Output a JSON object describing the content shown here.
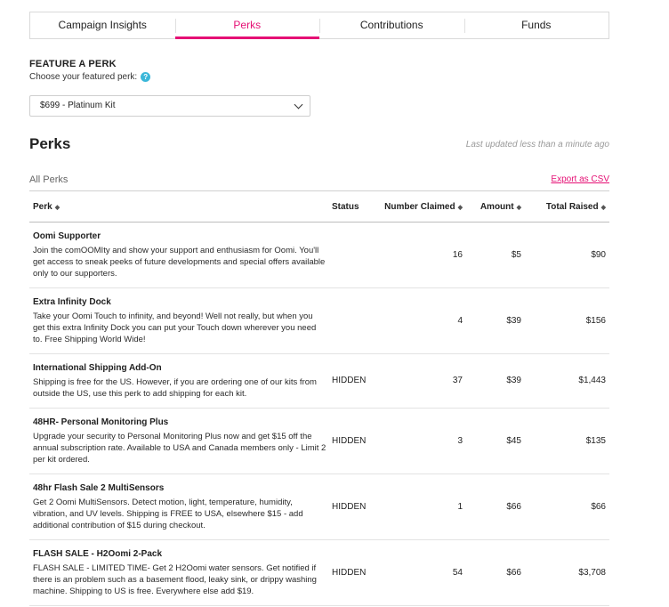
{
  "tabs": [
    {
      "label": "Campaign Insights",
      "active": false
    },
    {
      "label": "Perks",
      "active": true
    },
    {
      "label": "Contributions",
      "active": false
    },
    {
      "label": "Funds",
      "active": false
    }
  ],
  "feature": {
    "title": "FEATURE A PERK",
    "subtitle": "Choose your featured perk:",
    "help_icon": "?",
    "selected": "$699 - Platinum Kit"
  },
  "perks": {
    "title": "Perks",
    "last_updated": "Last updated less than a minute ago",
    "section_label": "All Perks",
    "export_label": "Export as CSV"
  },
  "table": {
    "headers": {
      "perk": "Perk",
      "status": "Status",
      "claimed": "Number Claimed",
      "amount": "Amount",
      "total": "Total Raised"
    },
    "rows": [
      {
        "name": "Oomi Supporter",
        "description": "Join the comOOMIty and show your support and enthusiasm for Oomi. You'll get access to sneak peeks of future developments and special offers available only to our supporters.",
        "status": "",
        "claimed": "16",
        "amount": "$5",
        "total": "$90"
      },
      {
        "name": "Extra Infinity Dock",
        "description": "Take your Oomi Touch to infinity, and beyond! Well not really, but when you get this extra Infinity Dock you can put your Touch down wherever you need to. Free Shipping World Wide!",
        "status": "",
        "claimed": "4",
        "amount": "$39",
        "total": "$156"
      },
      {
        "name": "International Shipping Add-On",
        "description": "Shipping is free for the US. However, if you are ordering one of our kits from outside the US, use this perk to add shipping for each kit.",
        "status": "HIDDEN",
        "claimed": "37",
        "amount": "$39",
        "total": "$1,443"
      },
      {
        "name": "48HR- Personal Monitoring Plus",
        "description": "Upgrade your security to Personal Monitoring Plus now and get $15 off the annual subscription rate. Available to USA and Canada members only - Limit 2 per kit ordered.",
        "status": "HIDDEN",
        "claimed": "3",
        "amount": "$45",
        "total": "$135"
      },
      {
        "name": "48hr Flash Sale 2 MultiSensors",
        "description": "Get 2 Oomi MultiSensors. Detect motion, light, temperature, humidity, vibration, and UV levels. Shipping is FREE to USA, elsewhere $15 - add additional contribution of $15 during checkout.",
        "status": "HIDDEN",
        "claimed": "1",
        "amount": "$66",
        "total": "$66"
      },
      {
        "name": "FLASH SALE - H2Oomi 2-Pack",
        "description": "FLASH SALE - LIMITED TIME- Get 2 H2Oomi water sensors. Get notified if there is an problem such as a basement flood, leaky sink, or drippy washing machine. Shipping to US is free. Everywhere else add $19.",
        "status": "HIDDEN",
        "claimed": "54",
        "amount": "$66",
        "total": "$3,708"
      }
    ]
  }
}
